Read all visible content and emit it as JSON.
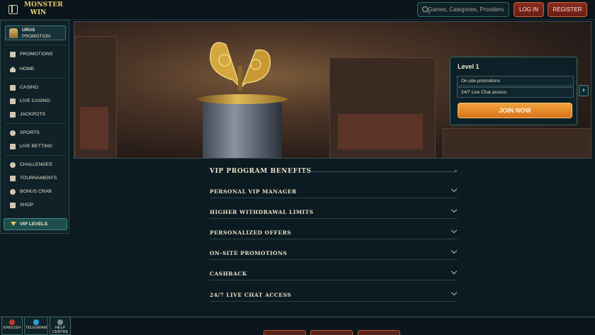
{
  "header": {
    "logo_line1": "MONSTER",
    "logo_line2": "WIN",
    "search_placeholder": "Games, Categories, Providers",
    "login_label": "LOG IN",
    "register_label": "REGISTER"
  },
  "sidebar": {
    "user_name": "URUS",
    "user_sub": "PROMOTION",
    "items": [
      {
        "label": "PROMOTIONS",
        "icon": "gift-icon"
      },
      {
        "label": "HOME",
        "icon": "home-icon"
      },
      {
        "label": "CASINO",
        "icon": "casino-icon"
      },
      {
        "label": "LIVE CASINO",
        "icon": "cards-icon"
      },
      {
        "label": "JACKPOTS",
        "icon": "jackpot-icon"
      },
      {
        "label": "SPORTS",
        "icon": "ball-icon"
      },
      {
        "label": "LIVE BETTING",
        "icon": "live-icon"
      },
      {
        "label": "CHALLENGES",
        "icon": "trophy-icon"
      },
      {
        "label": "TOURNAMENTS",
        "icon": "tournament-icon"
      },
      {
        "label": "BONUS CRAB",
        "icon": "crab-icon"
      },
      {
        "label": "SHOP",
        "icon": "shop-icon"
      }
    ],
    "vip_label": "VIP LEVELS"
  },
  "hero": {
    "level_title": "Level 1",
    "rows": [
      "On-site promotions",
      "24/7 Live Chat access"
    ],
    "join_label": "JOIN NOW"
  },
  "benefits": {
    "title": "VIP PROGRAM BENEFITS",
    "items": [
      "PERSONAL VIP MANAGER",
      "HIGHER WITHDRAWAL LIMITS",
      "PERSONALIZED OFFERS",
      "ON-SITE PROMOTIONS",
      "CASHBACK",
      "24/7 LIVE CHAT ACCESS"
    ]
  },
  "footer": {
    "buttons": [
      {
        "label": "ENGLISH",
        "color": "#c0392b"
      },
      {
        "label": "TELEGRAM",
        "color": "#2a9fd6"
      },
      {
        "label": "HELP CENTRE",
        "color": "#7a8a8c"
      }
    ]
  },
  "colors": {
    "accent": "#e8a23a",
    "danger": "#8a2b1e",
    "teal": "#3f8a83"
  }
}
